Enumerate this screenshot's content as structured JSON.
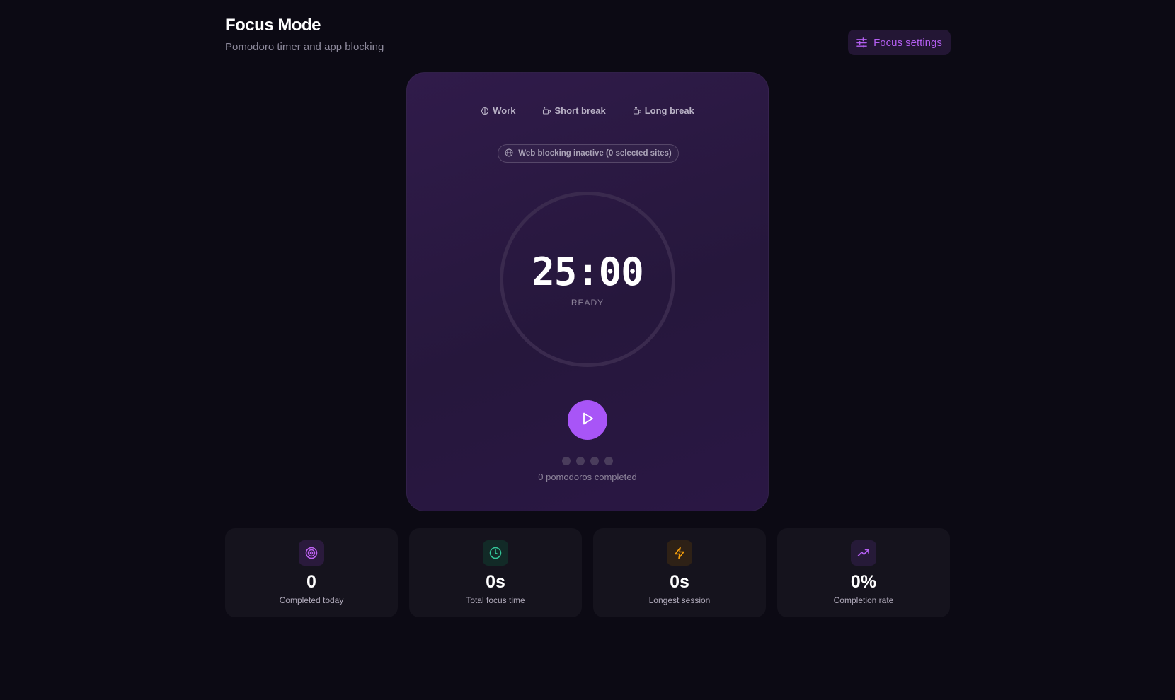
{
  "header": {
    "title": "Focus Mode",
    "subtitle": "Pomodoro timer and app blocking",
    "settings_label": "Focus settings"
  },
  "timer": {
    "tabs": [
      {
        "label": "Work",
        "icon": "brain-icon"
      },
      {
        "label": "Short break",
        "icon": "coffee-icon"
      },
      {
        "label": "Long break",
        "icon": "coffee-icon"
      }
    ],
    "blocking_status": "Web blocking inactive (0 selected sites)",
    "time": "25:00",
    "status": "READY",
    "pomodoro_dots_filled": 0,
    "pomodoro_dots_total": 4,
    "pomodoros_text": "0 pomodoros completed"
  },
  "stats": [
    {
      "value": "0",
      "label": "Completed today",
      "icon": "target-icon",
      "color": "#c063f5"
    },
    {
      "value": "0s",
      "label": "Total focus time",
      "icon": "clock-icon",
      "color": "#34c79a"
    },
    {
      "value": "0s",
      "label": "Longest session",
      "icon": "zap-icon",
      "color": "#f59e0b"
    },
    {
      "value": "0%",
      "label": "Completion rate",
      "icon": "trending-up-icon",
      "color": "#b45ff2"
    }
  ],
  "colors": {
    "background": "#0c0a14",
    "accent": "#a855f7",
    "card": "#15131d"
  }
}
